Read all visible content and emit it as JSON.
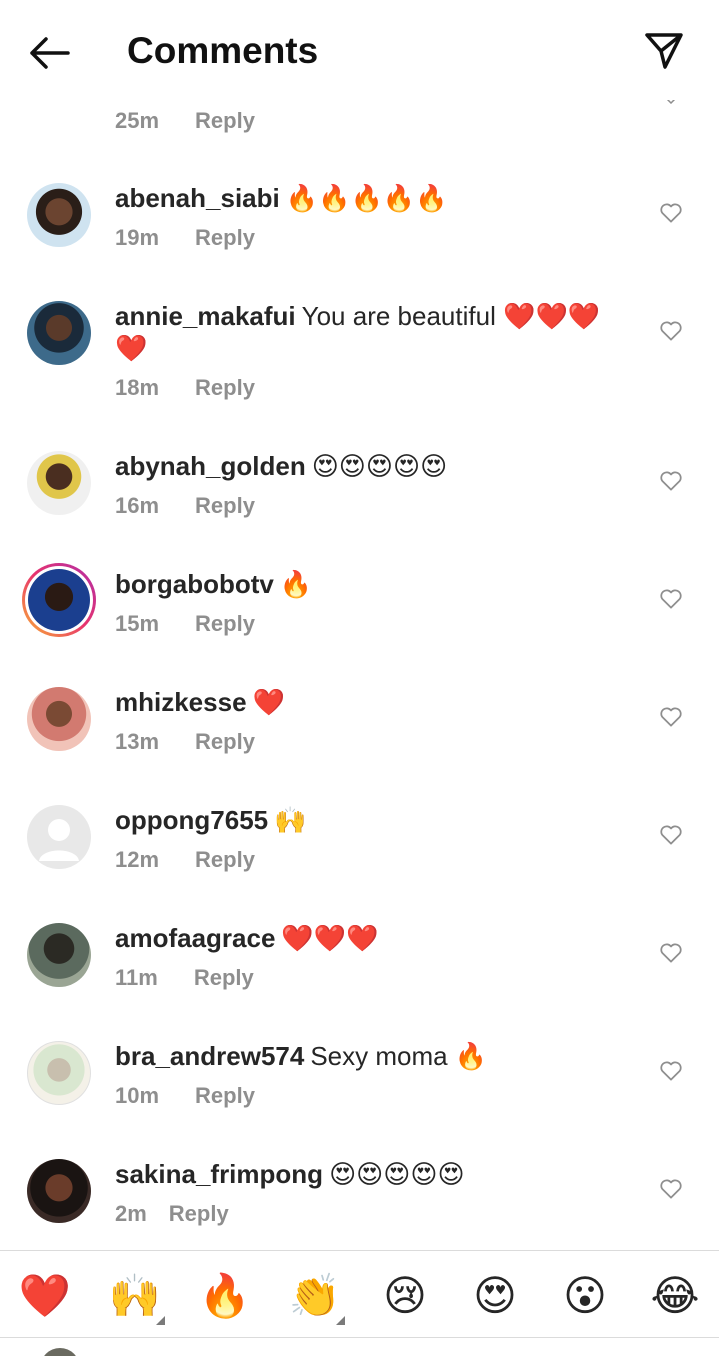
{
  "header": {
    "title": "Comments"
  },
  "comments": [
    {
      "username": "",
      "text": "",
      "time": "25m",
      "reply": "Reply",
      "has_story": true
    },
    {
      "username": "abenah_siabi",
      "text": "🔥🔥🔥🔥🔥",
      "time": "19m",
      "reply": "Reply",
      "has_story": false
    },
    {
      "username": "annie_makafui",
      "text": "You are beautiful ❤️❤️❤️❤️",
      "time": "18m",
      "reply": "Reply",
      "has_story": false
    },
    {
      "username": "abynah_golden",
      "text": "😍😍😍😍😍",
      "time": "16m",
      "reply": "Reply",
      "has_story": false
    },
    {
      "username": "borgabobotv",
      "text": "🔥",
      "time": "15m",
      "reply": "Reply",
      "has_story": true
    },
    {
      "username": "mhizkesse",
      "text": "❤️",
      "time": "13m",
      "reply": "Reply",
      "has_story": false
    },
    {
      "username": "oppong7655",
      "text": "🙌",
      "time": "12m",
      "reply": "Reply",
      "has_story": false
    },
    {
      "username": "amofaagrace",
      "text": "❤️❤️❤️",
      "time": "11m",
      "reply": "Reply",
      "has_story": false
    },
    {
      "username": "bra_andrew574",
      "text": "Sexy moma 🔥",
      "time": "10m",
      "reply": "Reply",
      "has_story": false
    },
    {
      "username": "sakina_frimpong",
      "text": "😍😍😍😍😍",
      "time": "2m",
      "reply": "Reply",
      "has_story": false
    }
  ],
  "reaction_bar": [
    "❤️",
    "🙌",
    "🔥",
    "👏",
    "😢",
    "😍",
    "😮",
    "😂"
  ],
  "colors": {
    "text": "#262626",
    "meta": "#8e8e8e",
    "divider": "#dbdbdb",
    "story_ring_start": "#f9b233",
    "story_ring_end": "#b02ea8"
  }
}
